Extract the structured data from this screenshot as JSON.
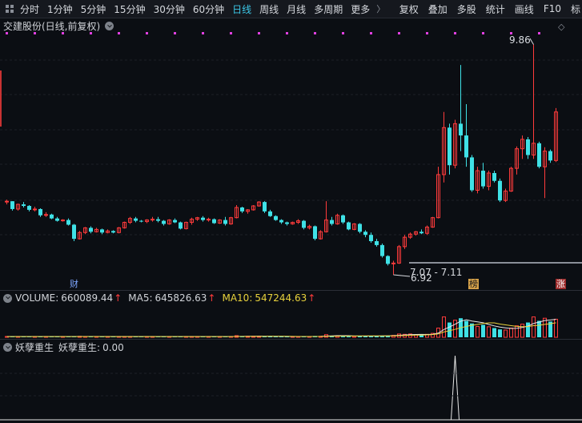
{
  "toolbar": {
    "periods": [
      "分时",
      "1分钟",
      "5分钟",
      "15分钟",
      "30分钟",
      "60分钟",
      "日线",
      "周线",
      "月线",
      "多周期"
    ],
    "active_period": "日线",
    "more_label": "更多",
    "more_chevron": "〉",
    "tools": [
      "复权",
      "叠加",
      "多股",
      "统计",
      "画线",
      "F10",
      "标"
    ],
    "left_icon": "grid-icon"
  },
  "main": {
    "title": "交建股份(日线,前复权)",
    "high_label": "9.86",
    "low_label": "6.92",
    "range_label": "7.07 - 7.11",
    "badges": {
      "cai": "财",
      "bang": "榜",
      "zhang": "涨"
    },
    "diamond_icon": "diamond-icon",
    "colors": {
      "up": "#ff3b3b",
      "down": "#3fe1e6",
      "marker": "#e040e0"
    }
  },
  "volume": {
    "label": "VOLUME:",
    "value": "660089.44",
    "ma5_label": "MA5:",
    "ma5_value": "645826.63",
    "ma10_label": "MA10:",
    "ma10_value": "547244.63",
    "arrow": "↑"
  },
  "indicator": {
    "label": "妖孽重生",
    "value_label": "妖孽重生:",
    "value": "0.00"
  },
  "chart_data": {
    "type": "candlestick",
    "price_range": [
      6.9,
      10.0
    ],
    "candles": [
      [
        7.85,
        7.88,
        7.82,
        7.86
      ],
      [
        7.86,
        7.86,
        7.74,
        7.76
      ],
      [
        7.76,
        7.83,
        7.74,
        7.82
      ],
      [
        7.82,
        7.85,
        7.78,
        7.8
      ],
      [
        7.8,
        7.81,
        7.73,
        7.75
      ],
      [
        7.75,
        7.79,
        7.73,
        7.76
      ],
      [
        7.76,
        7.77,
        7.66,
        7.68
      ],
      [
        7.68,
        7.72,
        7.66,
        7.69
      ],
      [
        7.69,
        7.7,
        7.63,
        7.64
      ],
      [
        7.64,
        7.66,
        7.6,
        7.61
      ],
      [
        7.61,
        7.63,
        7.6,
        7.62
      ],
      [
        7.62,
        7.64,
        7.55,
        7.56
      ],
      [
        7.56,
        7.57,
        7.35,
        7.38
      ],
      [
        7.38,
        7.48,
        7.37,
        7.46
      ],
      [
        7.46,
        7.53,
        7.44,
        7.52
      ],
      [
        7.52,
        7.54,
        7.45,
        7.47
      ],
      [
        7.47,
        7.52,
        7.46,
        7.5
      ],
      [
        7.5,
        7.51,
        7.44,
        7.46
      ],
      [
        7.46,
        7.5,
        7.45,
        7.48
      ],
      [
        7.48,
        7.49,
        7.45,
        7.46
      ],
      [
        7.46,
        7.53,
        7.45,
        7.52
      ],
      [
        7.52,
        7.6,
        7.51,
        7.59
      ],
      [
        7.59,
        7.66,
        7.57,
        7.64
      ],
      [
        7.64,
        7.66,
        7.59,
        7.61
      ],
      [
        7.61,
        7.62,
        7.59,
        7.6
      ],
      [
        7.6,
        7.63,
        7.58,
        7.62
      ],
      [
        7.62,
        7.66,
        7.6,
        7.63
      ],
      [
        7.63,
        7.66,
        7.59,
        7.61
      ],
      [
        7.61,
        7.62,
        7.55,
        7.57
      ],
      [
        7.57,
        7.63,
        7.56,
        7.62
      ],
      [
        7.62,
        7.64,
        7.58,
        7.59
      ],
      [
        7.59,
        7.6,
        7.5,
        7.51
      ],
      [
        7.51,
        7.6,
        7.5,
        7.59
      ],
      [
        7.59,
        7.65,
        7.56,
        7.63
      ],
      [
        7.63,
        7.66,
        7.61,
        7.65
      ],
      [
        7.65,
        7.67,
        7.6,
        7.62
      ],
      [
        7.62,
        7.65,
        7.6,
        7.63
      ],
      [
        7.63,
        7.64,
        7.57,
        7.58
      ],
      [
        7.58,
        7.63,
        7.57,
        7.62
      ],
      [
        7.62,
        7.66,
        7.55,
        7.57
      ],
      [
        7.57,
        7.66,
        7.56,
        7.65
      ],
      [
        7.65,
        7.81,
        7.64,
        7.78
      ],
      [
        7.78,
        7.79,
        7.71,
        7.73
      ],
      [
        7.73,
        7.76,
        7.7,
        7.75
      ],
      [
        7.75,
        7.81,
        7.74,
        7.8
      ],
      [
        7.8,
        7.86,
        7.79,
        7.85
      ],
      [
        7.85,
        7.86,
        7.71,
        7.73
      ],
      [
        7.73,
        7.75,
        7.66,
        7.67
      ],
      [
        7.67,
        7.68,
        7.61,
        7.62
      ],
      [
        7.62,
        7.63,
        7.57,
        7.59
      ],
      [
        7.59,
        7.6,
        7.55,
        7.57
      ],
      [
        7.57,
        7.6,
        7.56,
        7.59
      ],
      [
        7.59,
        7.63,
        7.57,
        7.61
      ],
      [
        7.61,
        7.62,
        7.5,
        7.52
      ],
      [
        7.52,
        7.56,
        7.5,
        7.54
      ],
      [
        7.54,
        7.55,
        7.36,
        7.38
      ],
      [
        7.38,
        7.49,
        7.37,
        7.47
      ],
      [
        7.47,
        7.86,
        7.46,
        7.62
      ],
      [
        7.62,
        7.66,
        7.55,
        7.57
      ],
      [
        7.57,
        7.7,
        7.56,
        7.68
      ],
      [
        7.68,
        7.69,
        7.57,
        7.59
      ],
      [
        7.59,
        7.6,
        7.49,
        7.5
      ],
      [
        7.5,
        7.58,
        7.49,
        7.57
      ],
      [
        7.57,
        7.58,
        7.45,
        7.47
      ],
      [
        7.47,
        7.49,
        7.4,
        7.43
      ],
      [
        7.43,
        7.46,
        7.33,
        7.35
      ],
      [
        7.35,
        7.38,
        7.28,
        7.3
      ],
      [
        7.3,
        7.32,
        7.14,
        7.16
      ],
      [
        7.16,
        7.17,
        7.04,
        7.06
      ],
      [
        7.06,
        7.1,
        6.92,
        7.07
      ],
      [
        7.07,
        7.3,
        7.06,
        7.28
      ],
      [
        7.28,
        7.43,
        7.25,
        7.4
      ],
      [
        7.4,
        7.46,
        7.38,
        7.44
      ],
      [
        7.44,
        7.48,
        7.42,
        7.47
      ],
      [
        7.47,
        7.5,
        7.44,
        7.45
      ],
      [
        7.45,
        7.55,
        7.43,
        7.53
      ],
      [
        7.53,
        7.66,
        7.52,
        7.65
      ],
      [
        7.65,
        8.3,
        7.64,
        8.2
      ],
      [
        8.2,
        9.0,
        8.1,
        8.8
      ],
      [
        8.8,
        8.85,
        8.2,
        8.32
      ],
      [
        8.32,
        8.9,
        8.28,
        8.85
      ],
      [
        8.85,
        9.6,
        8.5,
        8.7
      ],
      [
        8.7,
        9.1,
        8.3,
        8.42
      ],
      [
        8.42,
        8.45,
        7.98,
        8.0
      ],
      [
        8.0,
        8.3,
        7.96,
        8.25
      ],
      [
        8.25,
        8.35,
        8.02,
        8.05
      ],
      [
        8.05,
        8.25,
        8.0,
        8.22
      ],
      [
        8.22,
        8.25,
        8.1,
        8.12
      ],
      [
        8.12,
        8.15,
        7.85,
        7.87
      ],
      [
        7.87,
        8.02,
        7.85,
        7.99
      ],
      [
        7.99,
        8.3,
        7.98,
        8.28
      ],
      [
        8.28,
        8.56,
        8.2,
        8.53
      ],
      [
        8.53,
        8.7,
        8.4,
        8.65
      ],
      [
        8.65,
        8.68,
        8.4,
        8.45
      ],
      [
        8.45,
        9.86,
        8.4,
        8.6
      ],
      [
        8.6,
        8.62,
        8.28,
        8.3
      ],
      [
        8.3,
        8.55,
        7.9,
        8.5
      ],
      [
        8.5,
        8.52,
        8.35,
        8.38
      ],
      [
        8.38,
        9.05,
        8.36,
        9.0
      ]
    ],
    "volumes": [
      0.02,
      0.02,
      0.02,
      0.02,
      0.02,
      0.02,
      0.02,
      0.02,
      0.02,
      0.02,
      0.02,
      0.02,
      0.03,
      0.03,
      0.02,
      0.02,
      0.02,
      0.02,
      0.02,
      0.02,
      0.02,
      0.02,
      0.02,
      0.02,
      0.02,
      0.02,
      0.02,
      0.02,
      0.02,
      0.02,
      0.02,
      0.02,
      0.02,
      0.02,
      0.02,
      0.02,
      0.02,
      0.02,
      0.02,
      0.02,
      0.02,
      0.05,
      0.03,
      0.03,
      0.03,
      0.03,
      0.03,
      0.03,
      0.02,
      0.02,
      0.02,
      0.02,
      0.02,
      0.02,
      0.02,
      0.04,
      0.03,
      0.08,
      0.04,
      0.05,
      0.04,
      0.04,
      0.03,
      0.04,
      0.04,
      0.04,
      0.04,
      0.05,
      0.05,
      0.06,
      0.1,
      0.09,
      0.1,
      0.08,
      0.07,
      0.09,
      0.12,
      0.28,
      0.62,
      0.45,
      0.52,
      0.58,
      0.5,
      0.42,
      0.33,
      0.38,
      0.32,
      0.28,
      0.24,
      0.22,
      0.28,
      0.35,
      0.4,
      0.45,
      0.62,
      0.5,
      0.58,
      0.48,
      0.55
    ],
    "indicator_spike_index": 80
  }
}
